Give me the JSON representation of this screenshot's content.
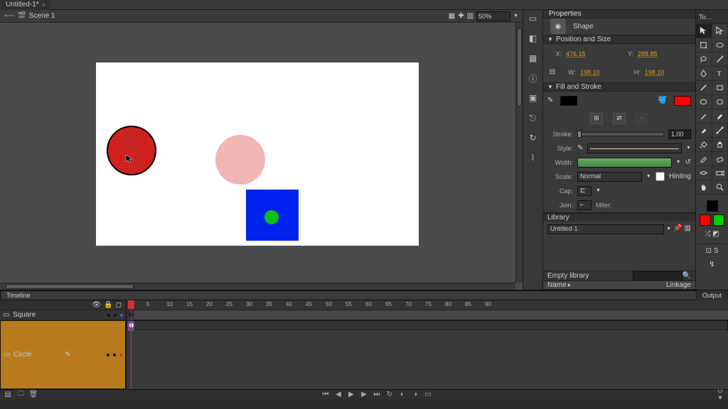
{
  "tabs": {
    "doc": "Untitled-1*"
  },
  "scene": {
    "name": "Scene 1",
    "zoom": "50%"
  },
  "properties": {
    "title": "Properties",
    "objectType": "Shape",
    "sections": {
      "positionSize": "Position and Size",
      "fillStroke": "Fill and Stroke"
    },
    "pos": {
      "xLabel": "X:",
      "x": "476.15",
      "yLabel": "Y:",
      "y": "288.85",
      "wLabel": "W:",
      "w": "198.10",
      "hLabel": "H:",
      "h": "198.10"
    },
    "stroke": {
      "label": "Stroke:",
      "value": "1.00",
      "colorFill": "#000000",
      "colorStroke": "#ff0000"
    },
    "style": {
      "label": "Style:"
    },
    "width": {
      "label": "Width:"
    },
    "scale": {
      "label": "Scale:",
      "value": "Normal",
      "hinting": "Hinting"
    },
    "cap": {
      "label": "Cap:"
    },
    "join": {
      "label": "Join:",
      "miter": "Miter:"
    }
  },
  "library": {
    "title": "Library",
    "doc": "Untitled-1",
    "empty": "Empty library",
    "cols": {
      "name": "Name",
      "linkage": "Linkage"
    },
    "searchPlaceholder": ""
  },
  "tools": {
    "title": "To…"
  },
  "timeline": {
    "tabs": {
      "timeline": "Timeline",
      "output": "Output"
    },
    "layers": [
      {
        "name": "Square",
        "selected": false
      },
      {
        "name": "Circle",
        "selected": true
      }
    ],
    "ruler": [
      1,
      5,
      10,
      15,
      20,
      25,
      30,
      35,
      40,
      45,
      50,
      55,
      60,
      65,
      70,
      75,
      80,
      85,
      90
    ],
    "playheadFrame": 1
  },
  "swatches": {
    "fg": "#000000",
    "bg": "#ffffff",
    "a": "#ff0000",
    "b": "#00cc00"
  }
}
